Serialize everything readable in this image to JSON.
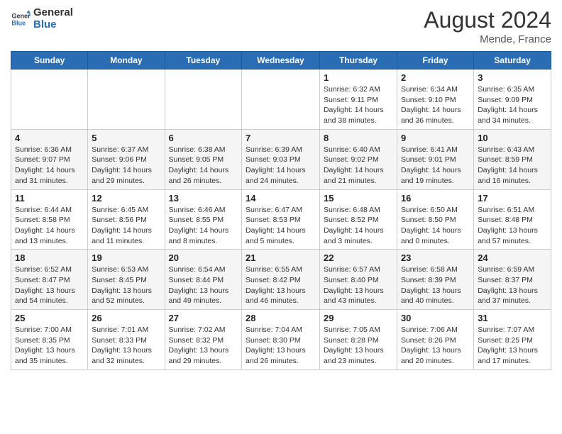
{
  "logo": {
    "line1": "General",
    "line2": "Blue"
  },
  "title": "August 2024",
  "location": "Mende, France",
  "days_header": [
    "Sunday",
    "Monday",
    "Tuesday",
    "Wednesday",
    "Thursday",
    "Friday",
    "Saturday"
  ],
  "weeks": [
    [
      {
        "day": "",
        "info": ""
      },
      {
        "day": "",
        "info": ""
      },
      {
        "day": "",
        "info": ""
      },
      {
        "day": "",
        "info": ""
      },
      {
        "day": "1",
        "info": "Sunrise: 6:32 AM\nSunset: 9:11 PM\nDaylight: 14 hours\nand 38 minutes."
      },
      {
        "day": "2",
        "info": "Sunrise: 6:34 AM\nSunset: 9:10 PM\nDaylight: 14 hours\nand 36 minutes."
      },
      {
        "day": "3",
        "info": "Sunrise: 6:35 AM\nSunset: 9:09 PM\nDaylight: 14 hours\nand 34 minutes."
      }
    ],
    [
      {
        "day": "4",
        "info": "Sunrise: 6:36 AM\nSunset: 9:07 PM\nDaylight: 14 hours\nand 31 minutes."
      },
      {
        "day": "5",
        "info": "Sunrise: 6:37 AM\nSunset: 9:06 PM\nDaylight: 14 hours\nand 29 minutes."
      },
      {
        "day": "6",
        "info": "Sunrise: 6:38 AM\nSunset: 9:05 PM\nDaylight: 14 hours\nand 26 minutes."
      },
      {
        "day": "7",
        "info": "Sunrise: 6:39 AM\nSunset: 9:03 PM\nDaylight: 14 hours\nand 24 minutes."
      },
      {
        "day": "8",
        "info": "Sunrise: 6:40 AM\nSunset: 9:02 PM\nDaylight: 14 hours\nand 21 minutes."
      },
      {
        "day": "9",
        "info": "Sunrise: 6:41 AM\nSunset: 9:01 PM\nDaylight: 14 hours\nand 19 minutes."
      },
      {
        "day": "10",
        "info": "Sunrise: 6:43 AM\nSunset: 8:59 PM\nDaylight: 14 hours\nand 16 minutes."
      }
    ],
    [
      {
        "day": "11",
        "info": "Sunrise: 6:44 AM\nSunset: 8:58 PM\nDaylight: 14 hours\nand 13 minutes."
      },
      {
        "day": "12",
        "info": "Sunrise: 6:45 AM\nSunset: 8:56 PM\nDaylight: 14 hours\nand 11 minutes."
      },
      {
        "day": "13",
        "info": "Sunrise: 6:46 AM\nSunset: 8:55 PM\nDaylight: 14 hours\nand 8 minutes."
      },
      {
        "day": "14",
        "info": "Sunrise: 6:47 AM\nSunset: 8:53 PM\nDaylight: 14 hours\nand 5 minutes."
      },
      {
        "day": "15",
        "info": "Sunrise: 6:48 AM\nSunset: 8:52 PM\nDaylight: 14 hours\nand 3 minutes."
      },
      {
        "day": "16",
        "info": "Sunrise: 6:50 AM\nSunset: 8:50 PM\nDaylight: 14 hours\nand 0 minutes."
      },
      {
        "day": "17",
        "info": "Sunrise: 6:51 AM\nSunset: 8:48 PM\nDaylight: 13 hours\nand 57 minutes."
      }
    ],
    [
      {
        "day": "18",
        "info": "Sunrise: 6:52 AM\nSunset: 8:47 PM\nDaylight: 13 hours\nand 54 minutes."
      },
      {
        "day": "19",
        "info": "Sunrise: 6:53 AM\nSunset: 8:45 PM\nDaylight: 13 hours\nand 52 minutes."
      },
      {
        "day": "20",
        "info": "Sunrise: 6:54 AM\nSunset: 8:44 PM\nDaylight: 13 hours\nand 49 minutes."
      },
      {
        "day": "21",
        "info": "Sunrise: 6:55 AM\nSunset: 8:42 PM\nDaylight: 13 hours\nand 46 minutes."
      },
      {
        "day": "22",
        "info": "Sunrise: 6:57 AM\nSunset: 8:40 PM\nDaylight: 13 hours\nand 43 minutes."
      },
      {
        "day": "23",
        "info": "Sunrise: 6:58 AM\nSunset: 8:39 PM\nDaylight: 13 hours\nand 40 minutes."
      },
      {
        "day": "24",
        "info": "Sunrise: 6:59 AM\nSunset: 8:37 PM\nDaylight: 13 hours\nand 37 minutes."
      }
    ],
    [
      {
        "day": "25",
        "info": "Sunrise: 7:00 AM\nSunset: 8:35 PM\nDaylight: 13 hours\nand 35 minutes."
      },
      {
        "day": "26",
        "info": "Sunrise: 7:01 AM\nSunset: 8:33 PM\nDaylight: 13 hours\nand 32 minutes."
      },
      {
        "day": "27",
        "info": "Sunrise: 7:02 AM\nSunset: 8:32 PM\nDaylight: 13 hours\nand 29 minutes."
      },
      {
        "day": "28",
        "info": "Sunrise: 7:04 AM\nSunset: 8:30 PM\nDaylight: 13 hours\nand 26 minutes."
      },
      {
        "day": "29",
        "info": "Sunrise: 7:05 AM\nSunset: 8:28 PM\nDaylight: 13 hours\nand 23 minutes."
      },
      {
        "day": "30",
        "info": "Sunrise: 7:06 AM\nSunset: 8:26 PM\nDaylight: 13 hours\nand 20 minutes."
      },
      {
        "day": "31",
        "info": "Sunrise: 7:07 AM\nSunset: 8:25 PM\nDaylight: 13 hours\nand 17 minutes."
      }
    ]
  ]
}
